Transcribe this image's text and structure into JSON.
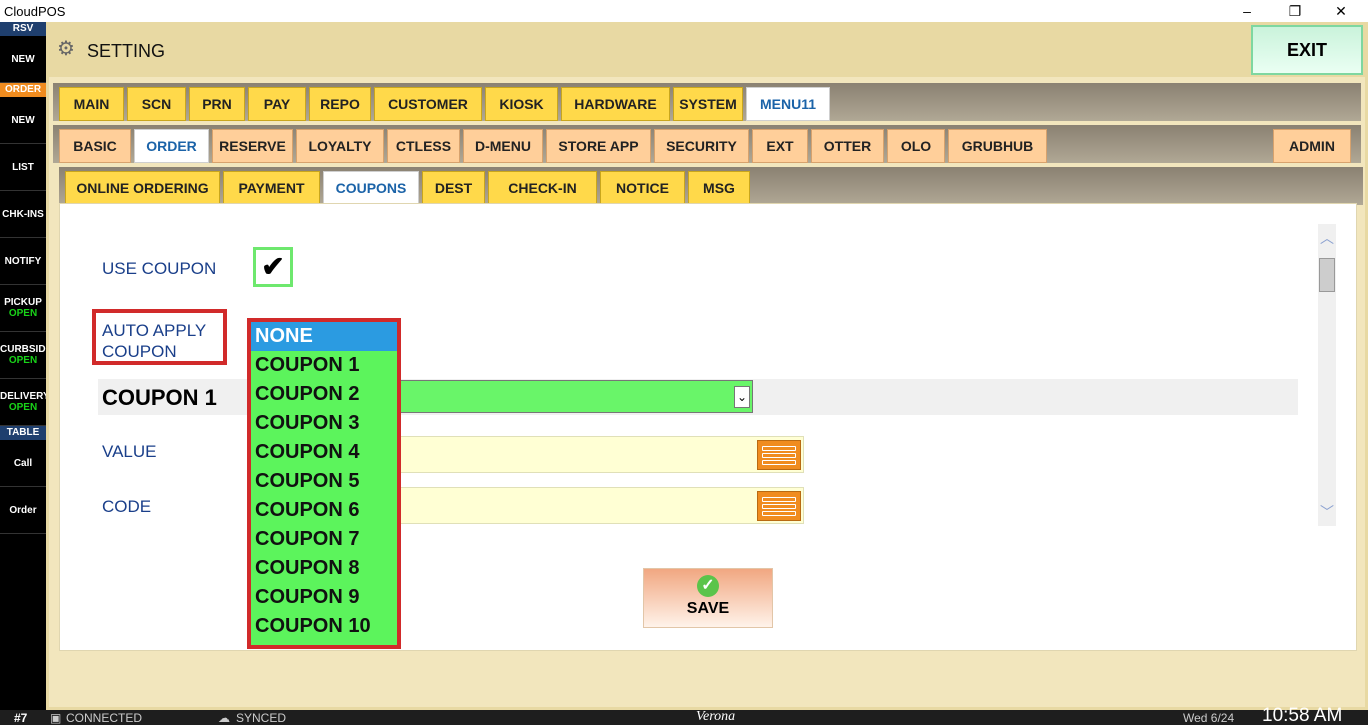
{
  "window": {
    "title": "CloudPOS",
    "minimize": "–",
    "restore": "❐",
    "close": "✕"
  },
  "header": {
    "title": "SETTING",
    "exit_label": "EXIT"
  },
  "sidebar": [
    {
      "type": "label",
      "text": "RSV",
      "color": "#1f3f6e"
    },
    {
      "type": "btn",
      "text": "NEW"
    },
    {
      "type": "label",
      "text": "ORDER",
      "color": "#f08c1f"
    },
    {
      "type": "btn",
      "text": "NEW"
    },
    {
      "type": "btn",
      "text": "LIST"
    },
    {
      "type": "btn",
      "text": "CHK-INS"
    },
    {
      "type": "btn",
      "text": "NOTIFY"
    },
    {
      "type": "btn",
      "text": "PICKUP",
      "sub": "OPEN"
    },
    {
      "type": "btn",
      "text": "CURBSIDE",
      "sub": "OPEN"
    },
    {
      "type": "btn",
      "text": "DELIVERY",
      "sub": "OPEN"
    },
    {
      "type": "label",
      "text": "TABLE",
      "color": "#1f3f6e"
    },
    {
      "type": "btn",
      "text": "Call"
    },
    {
      "type": "btn",
      "text": "Order"
    }
  ],
  "tabs1": [
    "MAIN",
    "SCN",
    "PRN",
    "PAY",
    "REPO",
    "CUSTOMER",
    "KIOSK",
    "HARDWARE",
    "SYSTEM",
    "MENU11"
  ],
  "tabs1_active": "MENU11",
  "tabs2": [
    "BASIC",
    "ORDER",
    "RESERVE",
    "LOYALTY",
    "CTLESS",
    "D-MENU",
    "STORE APP",
    "SECURITY",
    "EXT",
    "OTTER",
    "OLO",
    "GRUBHUB"
  ],
  "tabs2_active": "ORDER",
  "tabs2_admin": "ADMIN",
  "tabs3": [
    "ONLINE ORDERING",
    "PAYMENT",
    "COUPONS",
    "DEST",
    "CHECK-IN",
    "NOTICE",
    "MSG"
  ],
  "tabs3_active": "COUPONS",
  "form": {
    "use_coupon_label": "USE COUPON",
    "use_coupon_check": "✔",
    "auto_apply_label": "AUTO APPLY COUPON",
    "coupon_title": "COUPON 1",
    "value_label": "VALUE",
    "code_label": "CODE",
    "save_label": "SAVE"
  },
  "dropdown_options": [
    "NONE",
    "COUPON 1",
    "COUPON 2",
    "COUPON 3",
    "COUPON 4",
    "COUPON 5",
    "COUPON 6",
    "COUPON 7",
    "COUPON 8",
    "COUPON 9",
    "COUPON 10"
  ],
  "dropdown_selected": "NONE",
  "status": {
    "table": "#7",
    "connected": "CONNECTED",
    "synced": "SYNCED",
    "location": "Verona",
    "date": "Wed 6/24",
    "time": "10:58 AM"
  },
  "colors": {
    "accent_green": "#5cf45c",
    "highlight_red": "#d12a2a",
    "selected_blue": "#2b9be1",
    "tab_yellow": "#ffd94a"
  }
}
